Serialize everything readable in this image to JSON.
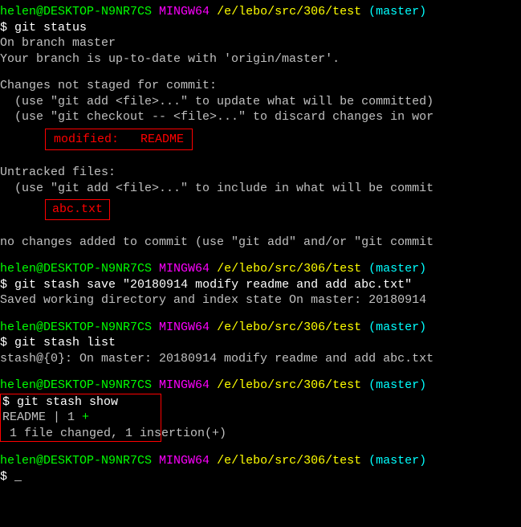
{
  "prompt": {
    "userhost": "helen@DESKTOP-N9NR7CS",
    "shell": "MINGW64",
    "path": "/e/lebo/src/306/test",
    "branch": "(master)",
    "dollar": "$"
  },
  "cmd1": "git status",
  "out1": {
    "l1": "On branch master",
    "l2": "Your branch is up-to-date with 'origin/master'.",
    "l3": "Changes not staged for commit:",
    "l4": "  (use \"git add <file>...\" to update what will be committed)",
    "l5": "  (use \"git checkout -- <file>...\" to discard changes in wor",
    "box1a": "modified:",
    "box1b": "README",
    "l6": "Untracked files:",
    "l7": "  (use \"git add <file>...\" to include in what will be commit",
    "box2": "abc.txt",
    "l8": "no changes added to commit (use \"git add\" and/or \"git commit"
  },
  "cmd2": "git stash save \"20180914 modify readme and add abc.txt\"",
  "out2": "Saved working directory and index state On master: 20180914 ",
  "cmd3": "git stash list",
  "out3": "stash@{0}: On master: 20180914 modify readme and add abc.txt",
  "cmd4": "git stash show",
  "out4": {
    "l1a": "README | 1 ",
    "l1b": "+",
    "l2a": " 1 file changed, 1 ",
    "l2b": "insertion(+)"
  }
}
